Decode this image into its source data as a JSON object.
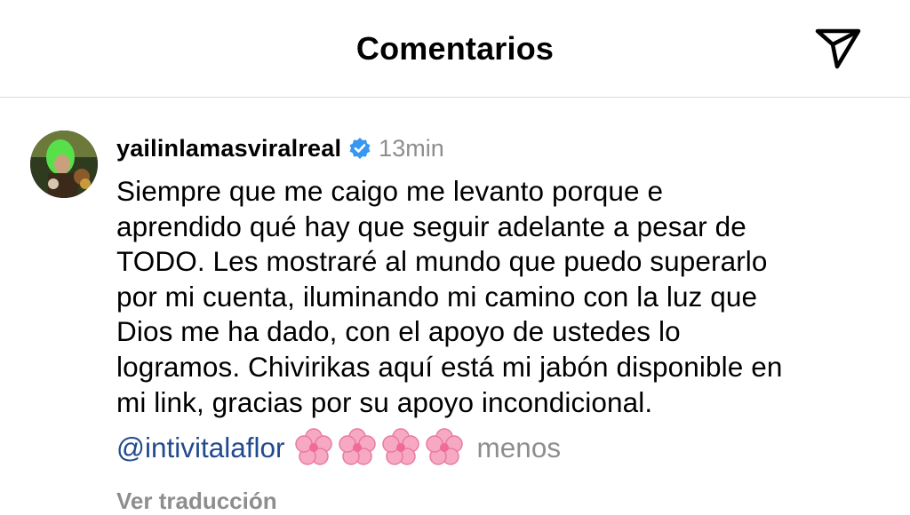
{
  "header": {
    "title": "Comentarios",
    "share_icon": "paper-plane-icon"
  },
  "comment": {
    "username": "yailinlamasviralreal",
    "verified_icon": "verified-badge-icon",
    "verified_color": "#3897f0",
    "timestamp": "13min",
    "lines": [
      "Siempre que me caigo me levanto porque e",
      "aprendido qué hay que seguir adelante a pesar de",
      "TODO. Les mostraré al mundo que puedo superarlo",
      "por mi cuenta, iluminando mi camino con la luz que",
      "Dios me ha dado, con el apoyo de ustedes lo",
      "logramos. Chivirikas aquí está mi jabón disponible en",
      "mi link, gracias por su apoyo incondicional."
    ],
    "mention": "@intivitalaflor",
    "emoji": [
      "🌸",
      "🌸",
      "🌸",
      "🌸"
    ],
    "less_label": "menos",
    "translate_label": "Ver traducción"
  },
  "colors": {
    "mention": "#224a8f",
    "muted": "#8e8e8e",
    "divider": "#dbdbdb"
  }
}
